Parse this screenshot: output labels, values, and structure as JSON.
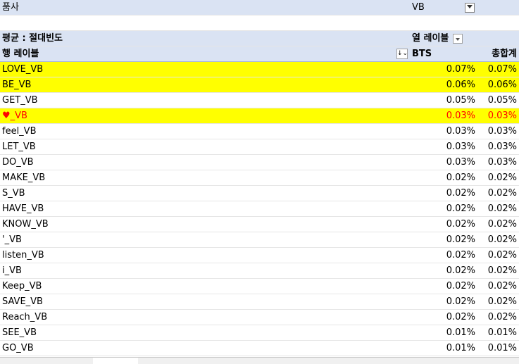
{
  "filter": {
    "field_label": "품사",
    "value": "VB"
  },
  "pivot": {
    "value_label": "평균 : 절대빈도",
    "column_labels_caption": "열 레이블",
    "row_labels_caption": "행 레이블",
    "col_bts": "BTS",
    "col_total": "총합계"
  },
  "rows": [
    {
      "label": "LOVE_VB",
      "bts": "0.07%",
      "total": "0.07%",
      "highlight": true,
      "red": false
    },
    {
      "label": "BE_VB",
      "bts": "0.06%",
      "total": "0.06%",
      "highlight": true,
      "red": false
    },
    {
      "label": "GET_VB",
      "bts": "0.05%",
      "total": "0.05%",
      "highlight": false,
      "red": false
    },
    {
      "label": "♥_VB",
      "bts": "0.03%",
      "total": "0.03%",
      "highlight": true,
      "red": true
    },
    {
      "label": "feel_VB",
      "bts": "0.03%",
      "total": "0.03%",
      "highlight": false,
      "red": false
    },
    {
      "label": "LET_VB",
      "bts": "0.03%",
      "total": "0.03%",
      "highlight": false,
      "red": false
    },
    {
      "label": "DO_VB",
      "bts": "0.03%",
      "total": "0.03%",
      "highlight": false,
      "red": false
    },
    {
      "label": "MAKE_VB",
      "bts": "0.02%",
      "total": "0.02%",
      "highlight": false,
      "red": false
    },
    {
      "label": "S_VB",
      "bts": "0.02%",
      "total": "0.02%",
      "highlight": false,
      "red": false
    },
    {
      "label": "HAVE_VB",
      "bts": "0.02%",
      "total": "0.02%",
      "highlight": false,
      "red": false
    },
    {
      "label": "KNOW_VB",
      "bts": "0.02%",
      "total": "0.02%",
      "highlight": false,
      "red": false
    },
    {
      "label": "'_VB",
      "bts": "0.02%",
      "total": "0.02%",
      "highlight": false,
      "red": false
    },
    {
      "label": "listen_VB",
      "bts": "0.02%",
      "total": "0.02%",
      "highlight": false,
      "red": false
    },
    {
      "label": "i_VB",
      "bts": "0.02%",
      "total": "0.02%",
      "highlight": false,
      "red": false
    },
    {
      "label": "Keep_VB",
      "bts": "0.02%",
      "total": "0.02%",
      "highlight": false,
      "red": false
    },
    {
      "label": "SAVE_VB",
      "bts": "0.02%",
      "total": "0.02%",
      "highlight": false,
      "red": false
    },
    {
      "label": "Reach_VB",
      "bts": "0.02%",
      "total": "0.02%",
      "highlight": false,
      "red": false
    },
    {
      "label": "SEE_VB",
      "bts": "0.01%",
      "total": "0.01%",
      "highlight": false,
      "red": false
    },
    {
      "label": "GO_VB",
      "bts": "0.01%",
      "total": "0.01%",
      "highlight": false,
      "red": false
    }
  ],
  "colors": {
    "header_bg": "#dae3f3",
    "highlight": "#ffff00",
    "red_text": "#ff0000"
  }
}
